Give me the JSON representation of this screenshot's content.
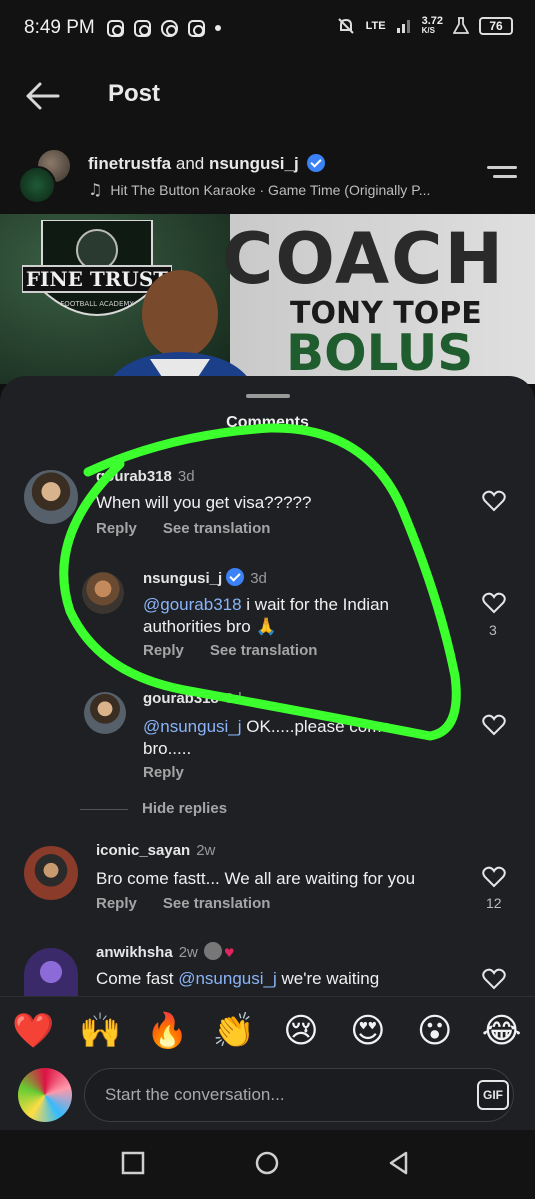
{
  "status_bar": {
    "time": "8:49 PM",
    "network": "LTE",
    "speed": "3.72",
    "speed_unit": "K/S",
    "battery": "76"
  },
  "header": {
    "title": "Post"
  },
  "post": {
    "author_primary": "finetrustfa",
    "author_joiner": "and",
    "author_secondary": "nsungusi_j",
    "music": "Hit The Button Karaoke · Game Time (Originally P..."
  },
  "banner": {
    "crest_title": "FINE TRUST",
    "crest_sub": "FOOTBALL ACADEMY",
    "coach": "COACH",
    "name1": "TONY TOPE",
    "name2": "BOLUS"
  },
  "sheet": {
    "title": "Comments"
  },
  "comments": [
    {
      "user": "gourab318",
      "time": "3d",
      "text": "When will you get visa?????",
      "reply": "Reply",
      "translate": "See translation",
      "likes": ""
    },
    {
      "user": "nsungusi_j",
      "time": "3d",
      "mention": "@gourab318",
      "text": " i wait for the Indian authorities bro 🙏",
      "reply": "Reply",
      "translate": "See translation",
      "likes": "3"
    },
    {
      "user": "gourab318",
      "time": "3d",
      "mention": "@nsungusi_j",
      "text": " OK.....please come bro.....",
      "reply": "Reply",
      "likes": ""
    },
    {
      "user": "iconic_sayan",
      "time": "2w",
      "text": "Bro come fastt... We all are waiting for you",
      "reply": "Reply",
      "translate": "See translation",
      "likes": "12"
    },
    {
      "user": "anwikhsha",
      "time": "2w",
      "mention": "@nsungusi_j",
      "text_pre": "Come fast ",
      "text": " we're waiting"
    }
  ],
  "hide_replies": "Hide replies",
  "emojis": [
    "❤️",
    "🙌",
    "🔥",
    "👏",
    "😢",
    "😍",
    "😮",
    "😂"
  ],
  "composer": {
    "placeholder": "Start the conversation...",
    "gif": "GIF"
  },
  "colors": {
    "highlight_scribble": "#3cff2e",
    "mention": "#8ab4f8",
    "sheet_bg": "#1e2024"
  }
}
